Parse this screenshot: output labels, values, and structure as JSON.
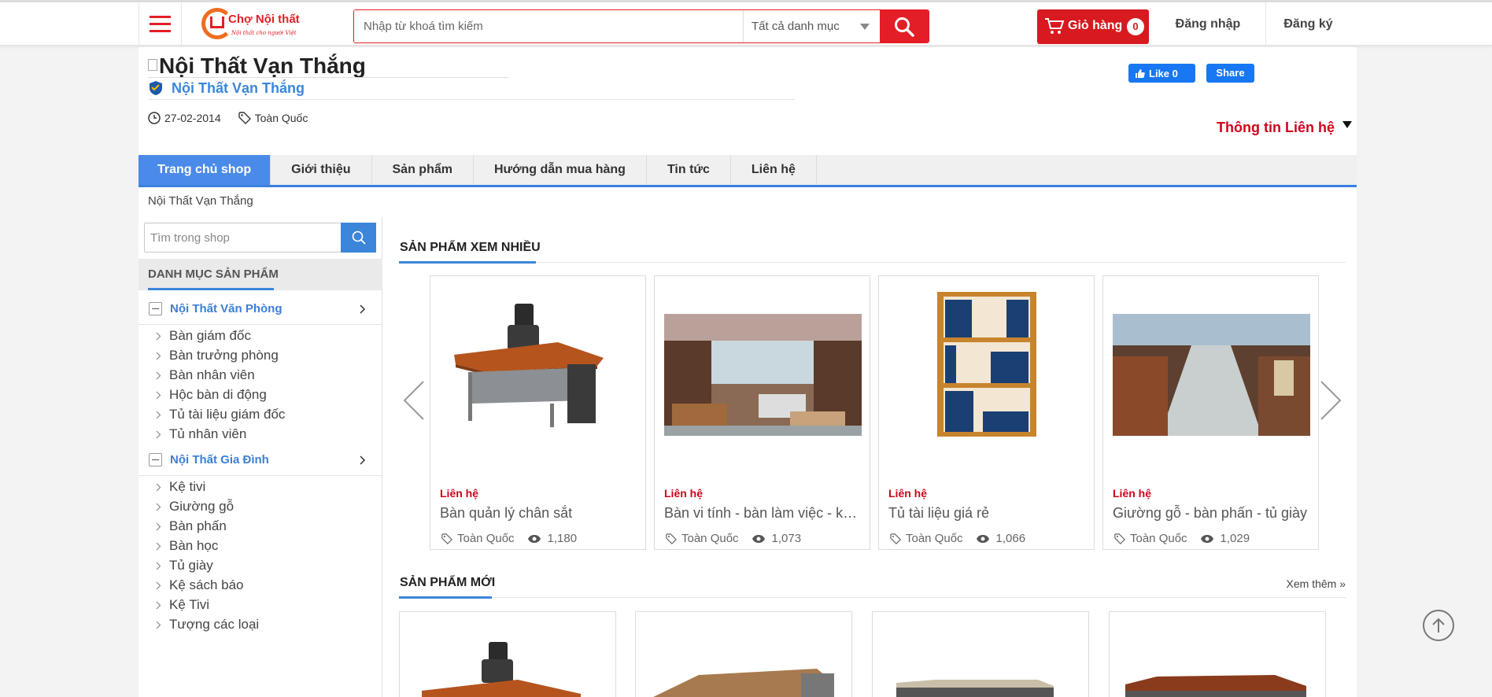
{
  "header": {
    "brand": "Chợ Nội thất",
    "slogan": "Nội thất cho người Việt",
    "search_placeholder": "Nhập từ khoá tìm kiếm",
    "category_select": "Tất cả danh mục",
    "cart_label": "Giỏ hàng",
    "cart_count": "0",
    "login": "Đăng nhập",
    "register": "Đăng ký"
  },
  "shop": {
    "name_image_alt": "Nội Thất Vạn Thắng",
    "name_link": "Nội Thất Vạn Thắng",
    "date": "27-02-2014",
    "location": "Toàn Quốc",
    "fb_like": "Like 0",
    "fb_share": "Share",
    "contact_info": "Thông tin Liên hệ"
  },
  "nav": [
    "Trang chủ shop",
    "Giới thiệu",
    "Sản phẩm",
    "Hướng dẫn mua hàng",
    "Tin tức",
    "Liên hệ"
  ],
  "breadcrumb": "Nội Thất Vạn Thắng",
  "sidebar": {
    "search_placeholder": "Tìm trong shop",
    "category_title": "DANH MỤC SẢN PHẨM",
    "groups": [
      {
        "label": "Nội Thất Văn Phòng",
        "items": [
          "Bàn giám đốc",
          "Bàn trưởng phòng",
          "Bàn nhân viên",
          "Hộc bàn di động",
          "Tủ tài liệu giám đốc",
          "Tủ nhân viên"
        ]
      },
      {
        "label": "Nội Thất Gia Đình",
        "items": [
          "Kệ tivi",
          "Giường gỗ",
          "Bàn phấn",
          "Bàn học",
          "Tủ giày",
          "Kệ sách báo",
          "Kệ Tivi",
          "Tượng các loại"
        ]
      }
    ]
  },
  "most_viewed": {
    "title": "SẢN PHẨM XEM NHIỀU",
    "products": [
      {
        "price": "Liên hệ",
        "title": "Bàn quản lý chân sắt",
        "location": "Toàn Quốc",
        "views": "1,180",
        "icon": "office-desk-icon"
      },
      {
        "price": "Liên hệ",
        "title": "Bàn vi tính - bàn làm việc - kệ tivi",
        "location": "Toàn Quốc",
        "views": "1,073",
        "icon": "showroom-photo"
      },
      {
        "price": "Liên hệ",
        "title": "Tủ tài liệu giá rẻ",
        "location": "Toàn Quốc",
        "views": "1,066",
        "icon": "bookshelf-icon"
      },
      {
        "price": "Liên hệ",
        "title": "Giường gỗ - bàn phấn - tủ giày",
        "location": "Toàn Quốc",
        "views": "1,029",
        "icon": "store-aisle-photo"
      }
    ]
  },
  "new_products": {
    "title": "SẢN PHẨM MỚI",
    "more": "Xem thêm »"
  },
  "colors": {
    "brand_red": "#e41e26",
    "link_blue": "#3b86d9",
    "price_red": "#d0021b"
  }
}
